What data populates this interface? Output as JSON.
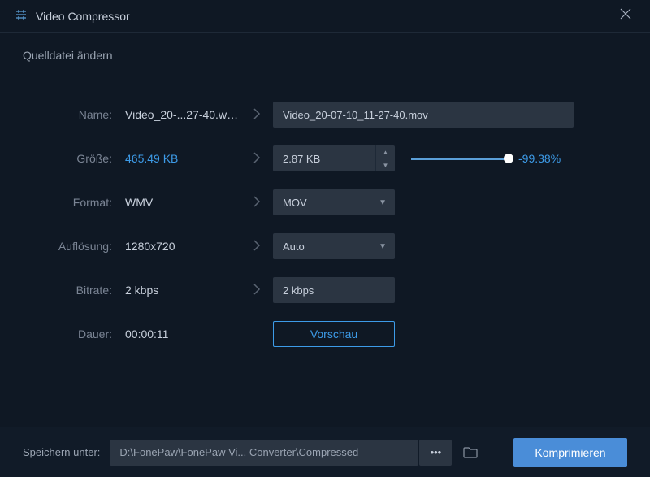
{
  "title": "Video Compressor",
  "subheader": "Quelldatei ändern",
  "labels": {
    "name": "Name:",
    "size": "Größe:",
    "format": "Format:",
    "resolution": "Auflösung:",
    "bitrate": "Bitrate:",
    "duration": "Dauer:"
  },
  "source": {
    "name": "Video_20-...27-40.wmv",
    "size": "465.49 KB",
    "format": "WMV",
    "resolution": "1280x720",
    "bitrate": "2 kbps",
    "duration": "00:00:11"
  },
  "target": {
    "name": "Video_20-07-10_11-27-40.mov",
    "size": "2.87 KB",
    "format": "MOV",
    "resolution": "Auto",
    "bitrate": "2 kbps"
  },
  "size_reduction_pct": "-99.38%",
  "preview_label": "Vorschau",
  "footer": {
    "save_label": "Speichern unter:",
    "path": "D:\\FonePaw\\FonePaw Vi... Converter\\Compressed",
    "compress_label": "Komprimieren"
  }
}
